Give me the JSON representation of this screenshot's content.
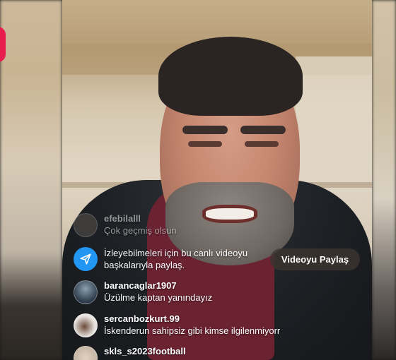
{
  "live": {
    "badge_color": "#e81c4f"
  },
  "comments": [
    {
      "username": "efebilalll",
      "message": "Çok geçmiş olsun",
      "faded": true,
      "avatar_color": "#5a5550"
    },
    {
      "username": "barancaglar1907",
      "message": "Üzülme kaptan yanındayız",
      "faded": false,
      "avatar_color": "#2d3b4a"
    },
    {
      "username": "sercanbozkurt.99",
      "message": "İskenderun sahipsiz gibi kimse ilgilenmiyorr",
      "faded": false,
      "avatar_color": "#e8e4df"
    },
    {
      "username": "skls_s2023football",
      "message": "",
      "faded": false,
      "avatar_color": "#c9b9a8"
    }
  ],
  "share_prompt": {
    "line1": "İzleyebilmeleri için bu canlı videoyu",
    "line2": "başkalarıyla paylaş.",
    "icon": "paper-plane-icon",
    "icon_color": "#2196f3",
    "button_label": "Videoyu Paylaş"
  }
}
